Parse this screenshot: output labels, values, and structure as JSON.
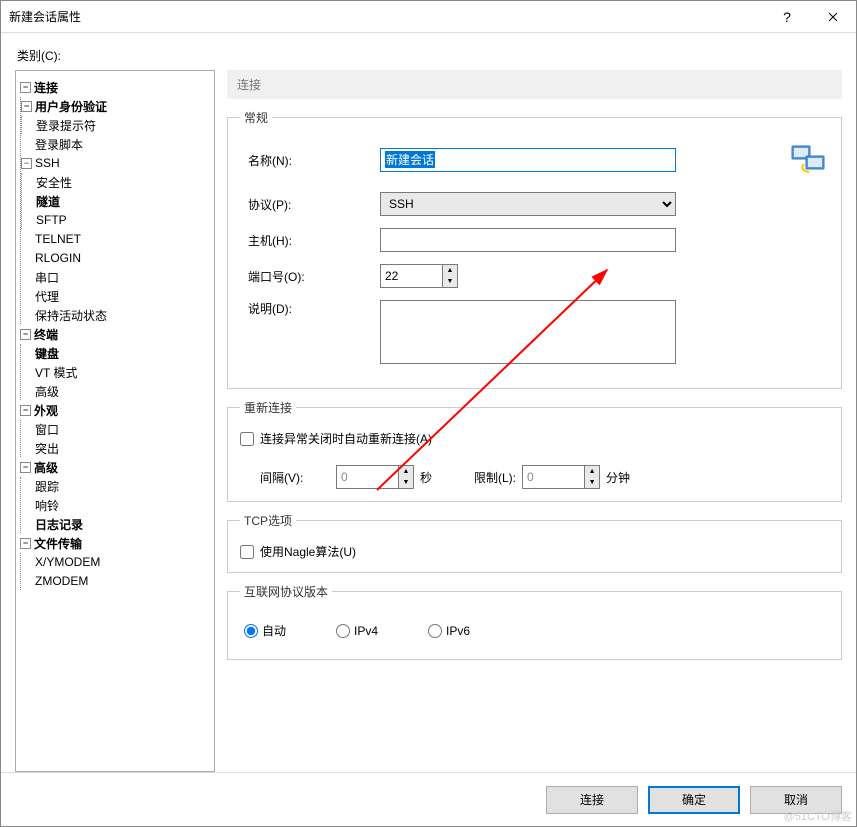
{
  "window": {
    "title": "新建会话属性"
  },
  "category_label": "类别(C):",
  "tree": {
    "connection": "连接",
    "auth": "用户身份验证",
    "login_prompt": "登录提示符",
    "login_script": "登录脚本",
    "ssh": "SSH",
    "security": "安全性",
    "tunnel": "隧道",
    "sftp": "SFTP",
    "telnet": "TELNET",
    "rlogin": "RLOGIN",
    "serial": "串口",
    "proxy": "代理",
    "keepalive": "保持活动状态",
    "terminal": "终端",
    "keyboard": "键盘",
    "vt": "VT 模式",
    "advanced_term": "高级",
    "appearance": "外观",
    "window_item": "窗口",
    "highlight": "突出",
    "advanced": "高级",
    "trace": "跟踪",
    "bell": "响铃",
    "logging": "日志记录",
    "filetransfer": "文件传输",
    "xymodem": "X/YMODEM",
    "zmodem": "ZMODEM"
  },
  "page": {
    "heading": "连接",
    "general_legend": "常规",
    "name_label": "名称(N):",
    "name_value": "新建会话",
    "protocol_label": "协议(P):",
    "protocol_value": "SSH",
    "host_label": "主机(H):",
    "host_value": "",
    "port_label": "端口号(O):",
    "port_value": "22",
    "desc_label": "说明(D):",
    "desc_value": "",
    "reconnect_legend": "重新连接",
    "reconnect_checkbox": "连接异常关闭时自动重新连接(A)",
    "interval_label": "间隔(V):",
    "interval_value": "0",
    "interval_unit": "秒",
    "limit_label": "限制(L):",
    "limit_value": "0",
    "limit_unit": "分钟",
    "tcp_legend": "TCP选项",
    "nagle_checkbox": "使用Nagle算法(U)",
    "ipver_legend": "互联网协议版本",
    "ip_auto": "自动",
    "ip_v4": "IPv4",
    "ip_v6": "IPv6"
  },
  "buttons": {
    "connect": "连接",
    "ok": "确定",
    "cancel": "取消"
  },
  "watermark": "@51CTO博客"
}
